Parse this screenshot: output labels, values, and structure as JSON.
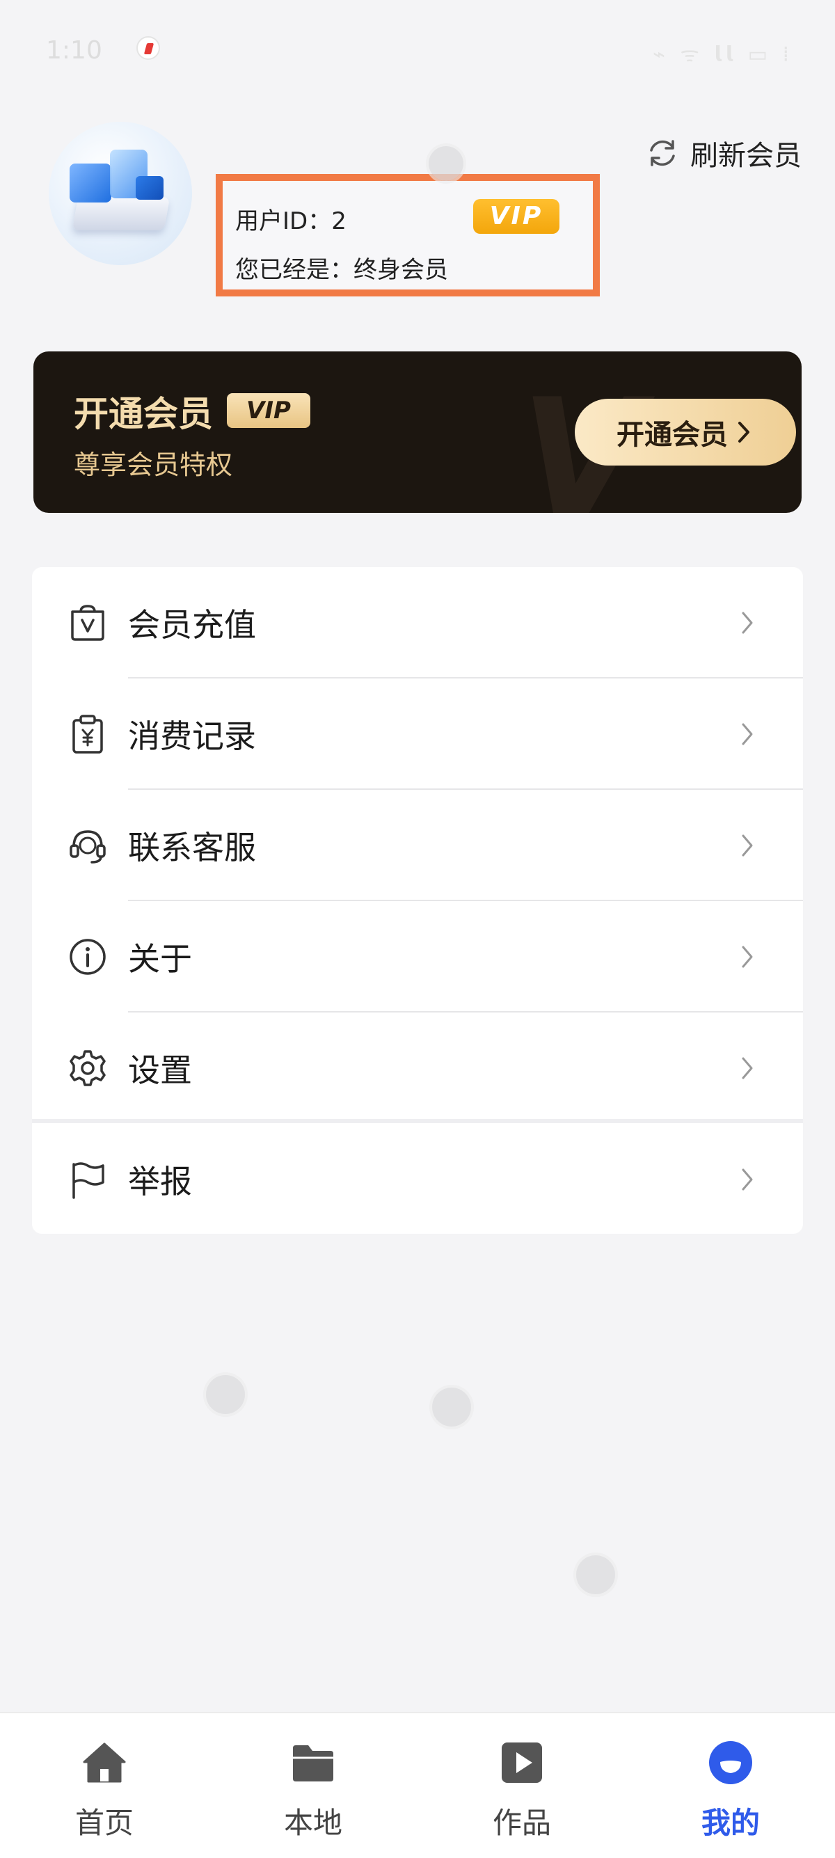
{
  "status_bar": {
    "time": "1:10",
    "system": "⌁ ᯤ 𝗹𝗹 ▭ ⁞"
  },
  "header": {
    "refresh_label": "刷新会员",
    "user_id_label": "用户ID：2",
    "vip_badge": "VIP",
    "member_status": "您已经是：终身会员"
  },
  "vip_banner": {
    "title": "开通会员",
    "tag": "VIP",
    "subtitle": "尊享会员特权",
    "button_label": "开通会员"
  },
  "menu": {
    "items": [
      {
        "label": "会员充值",
        "icon": "vip-bag-icon"
      },
      {
        "label": "消费记录",
        "icon": "receipt-icon"
      },
      {
        "label": "联系客服",
        "icon": "headset-icon"
      },
      {
        "label": "关于",
        "icon": "info-icon"
      },
      {
        "label": "设置",
        "icon": "gear-icon"
      },
      {
        "label": "举报",
        "icon": "flag-icon"
      }
    ]
  },
  "bottom_nav": {
    "items": [
      {
        "label": "首页",
        "icon": "home-icon"
      },
      {
        "label": "本地",
        "icon": "folder-icon"
      },
      {
        "label": "作品",
        "icon": "play-icon"
      },
      {
        "label": "我的",
        "icon": "profile-icon"
      }
    ],
    "active_index": 3,
    "active_color": "#2f5bea"
  }
}
